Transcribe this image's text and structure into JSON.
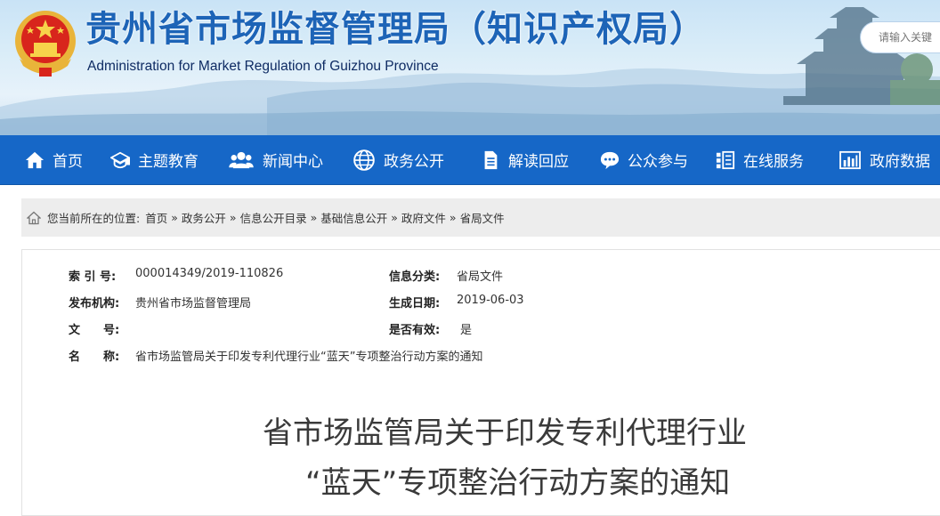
{
  "header": {
    "title": "贵州省市场监督管理局（知识产权局）",
    "subtitle": "Administration for Market Regulation of Guizhou Province",
    "search_placeholder": "请输入关键",
    "colors": {
      "title": "#1d64b7",
      "nav": "#1667c7"
    }
  },
  "nav": {
    "items": [
      {
        "label": "首页",
        "icon": "home-icon"
      },
      {
        "label": "主题教育",
        "icon": "graduation-cap-icon"
      },
      {
        "label": "新闻中心",
        "icon": "users-icon"
      },
      {
        "label": "政务公开",
        "icon": "globe-icon"
      },
      {
        "label": "解读回应",
        "icon": "document-icon"
      },
      {
        "label": "公众参与",
        "icon": "chat-bubble-icon"
      },
      {
        "label": "在线服务",
        "icon": "list-icon"
      },
      {
        "label": "政府数据",
        "icon": "bar-chart-icon"
      }
    ]
  },
  "breadcrumb": {
    "prefix": "您当前所在的位置:",
    "items": [
      "首页",
      "政务公开",
      "信息公开目录",
      "基础信息公开",
      "政府文件",
      "省局文件"
    ],
    "separator": "»"
  },
  "meta": {
    "index_label": "索 引 号:",
    "index_value": "000014349/2019-110826",
    "category_label": "信息分类:",
    "category_value": "省局文件",
    "publisher_label": "发布机构:",
    "publisher_value": "贵州省市场监督管理局",
    "date_label": "生成日期:",
    "date_value": "2019-06-03",
    "docno_label": "文　　号:",
    "docno_value": "",
    "valid_label": "是否有效:",
    "valid_value": "是",
    "name_label": "名　　称:",
    "name_value": "省市场监管局关于印发专利代理行业“蓝天”专项整治行动方案的通知"
  },
  "article": {
    "title_line1": "省市场监管局关于印发专利代理行业",
    "title_line2": "“蓝天”专项整治行动方案的通知"
  }
}
